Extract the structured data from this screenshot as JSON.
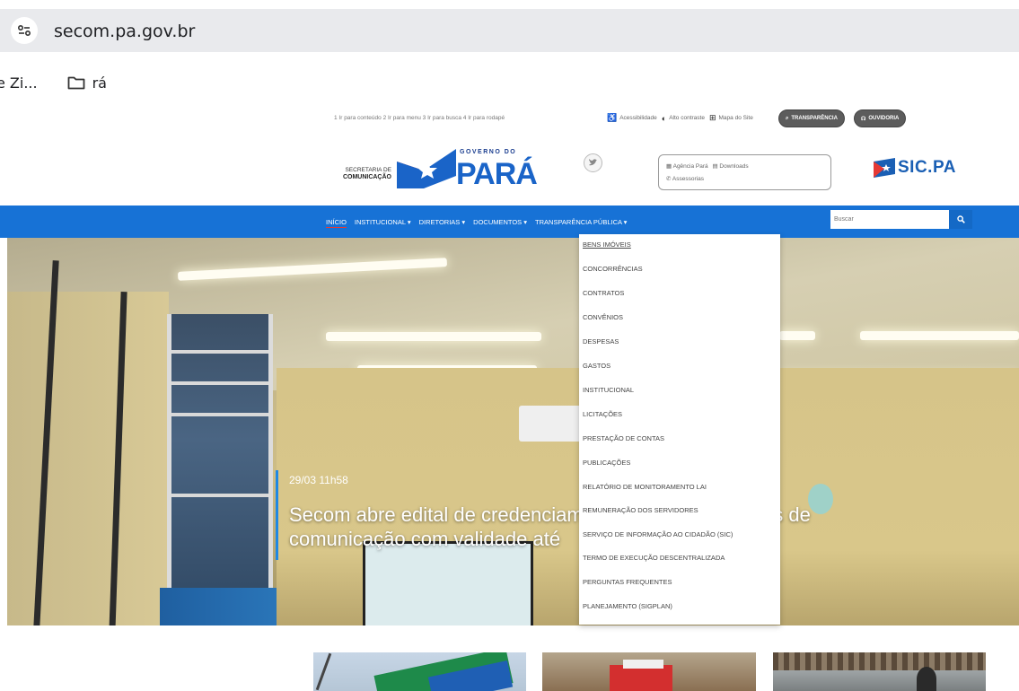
{
  "browser": {
    "url": "secom.pa.gov.br",
    "bookmarks": [
      {
        "label": "e Zi..."
      },
      {
        "label": "rá"
      }
    ]
  },
  "site": {
    "skip_links": "1  Ir para conteúdo  2  Ir para menu  3  Ir para busca  4  Ir para rodapé",
    "accessibility": [
      "Acessibilidade",
      "Alto contraste",
      "Mapa do Site"
    ],
    "transparencia_btn": "TRANSPARÊNCIA",
    "ouvidoria_btn": "OUVIDORIA",
    "secretaria_line1": "SECRETARIA DE",
    "secretaria_line2": "COMUNICAÇÃO",
    "governo_do": "GOVERNO DO",
    "para": "PARÁ",
    "links_box": {
      "agencia": "Agência Pará",
      "downloads": "Downloads",
      "assessorias": "Assessorias"
    },
    "sicpa": "SIC.PA",
    "nav": [
      {
        "label": "INÍCIO"
      },
      {
        "label": "INSTITUCIONAL ▾"
      },
      {
        "label": "DIRETORIAS ▾"
      },
      {
        "label": "DOCUMENTOS ▾"
      },
      {
        "label": "TRANSPARÊNCIA PÚBLICA ▾"
      }
    ],
    "search_placeholder": "Buscar",
    "hero": {
      "date": "29/03 11h58",
      "title": "Secom abre edital de credenciamento de veículos locais de comunicação com validade até"
    },
    "dropdown": [
      "BENS IMÓVEIS",
      "CONCORRÊNCIAS",
      "CONTRATOS",
      "CONVÊNIOS",
      "DESPESAS",
      "GASTOS",
      "INSTITUCIONAL",
      "LICITAÇÕES",
      "PRESTAÇÃO DE CONTAS",
      "PUBLICAÇÕES",
      "RELATÓRIO DE MONITORAMENTO LAI",
      "REMUNERAÇÃO DOS SERVIDORES",
      "SERVIÇO DE INFORMAÇÃO AO CIDADÃO (SIC)",
      "TERMO DE EXECUÇÃO DESCENTRALIZADA",
      "PERGUNTAS FREQUENTES",
      "PLANEJAMENTO (SIGPLAN)"
    ]
  },
  "colors": {
    "nav_blue": "#1772d6",
    "accent_red": "#e53935"
  }
}
